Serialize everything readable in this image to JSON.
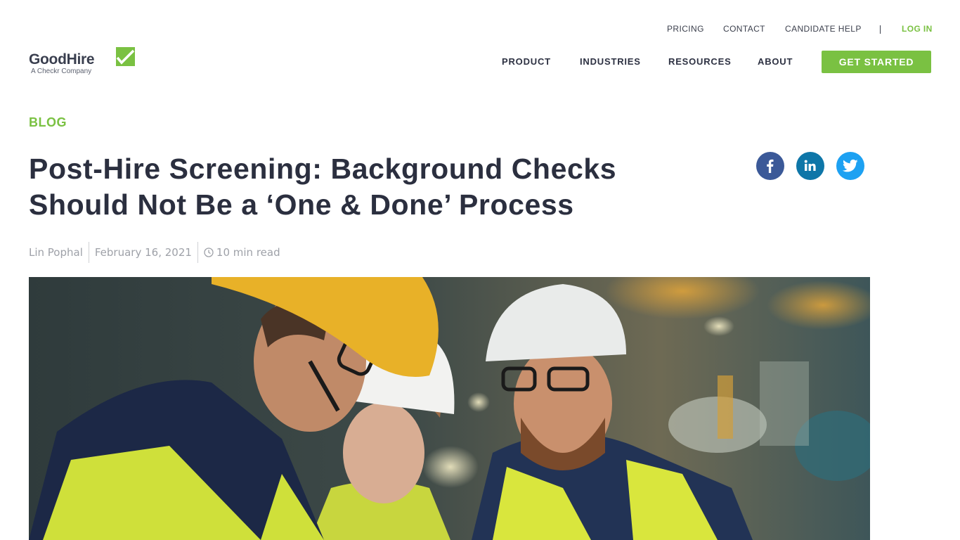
{
  "top_nav": {
    "pricing": "PRICING",
    "contact": "CONTACT",
    "candidate_help": "CANDIDATE HELP",
    "login": "LOG IN"
  },
  "logo": {
    "name": "GoodHire",
    "tagline": "A Checkr Company",
    "icon": "check-icon"
  },
  "main_nav": {
    "product": "PRODUCT",
    "industries": "INDUSTRIES",
    "resources": "RESOURCES",
    "about": "ABOUT",
    "cta": "GET STARTED"
  },
  "article": {
    "category": "BLOG",
    "title": "Post-Hire Screening: Background Checks Should Not Be a ‘One & Done’ Process",
    "author": "Lin Pophal",
    "date": "February 16, 2021",
    "read_time": "10 min read"
  },
  "social": {
    "facebook_icon": "facebook-icon",
    "linkedin_icon": "linkedin-icon",
    "twitter_icon": "twitter-icon"
  },
  "colors": {
    "brand_green": "#7ac142",
    "text_dark": "#2b2f3f",
    "facebook": "#3b5998",
    "linkedin": "#0e76a8",
    "twitter": "#1da1f2"
  }
}
